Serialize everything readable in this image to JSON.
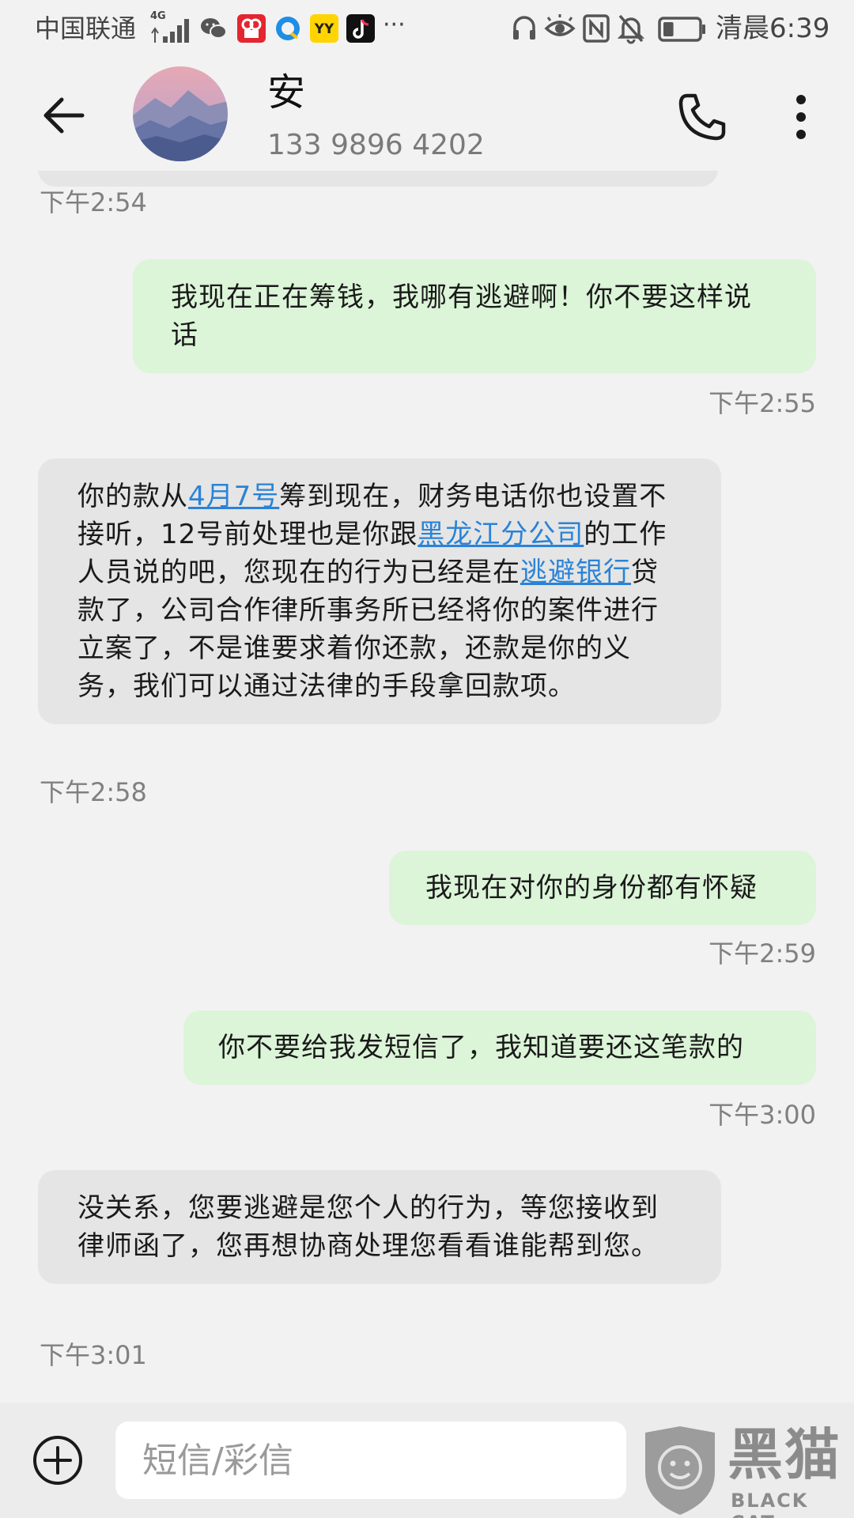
{
  "status_bar": {
    "carrier": "中国联通",
    "network": "4G",
    "time": "清晨6:39",
    "more": "···",
    "notification_icons": [
      "wechat-icon",
      "video-app-icon",
      "browser-app-icon",
      "yy-app-icon",
      "tiktok-icon"
    ],
    "system_icons": [
      "headset-icon",
      "eye-comfort-icon",
      "nfc-icon",
      "mute-icon",
      "battery-icon"
    ],
    "battery_level": 0.3
  },
  "header": {
    "contact_name": "安",
    "contact_number": "133 9896 4202",
    "back_icon": "back-arrow-icon",
    "call_icon": "phone-icon",
    "more_icon": "more-vertical-icon"
  },
  "messages": [
    {
      "direction": "incoming",
      "time": "下午2:54"
    },
    {
      "direction": "outgoing",
      "text": "我现在正在筹钱，我哪有逃避啊！你不要这样说话",
      "time": "下午2:55"
    },
    {
      "direction": "incoming",
      "segments": [
        {
          "text": "你的款从",
          "link": false
        },
        {
          "text": "4月7号",
          "link": true
        },
        {
          "text": "筹到现在，财务电话你也设置不接听，12号前处理也是你跟",
          "link": false
        },
        {
          "text": "黑龙江分公司",
          "link": true
        },
        {
          "text": "的工作人员说的吧，您现在的行为已经是在",
          "link": false
        },
        {
          "text": "逃避银行",
          "link": true
        },
        {
          "text": "贷款了，公司合作律所事务所已经将你的案件进行立案了，不是谁要求着你还款，还款是你的义务，我们可以通过法律的手段拿回款项。",
          "link": false
        }
      ],
      "time": "下午2:58"
    },
    {
      "direction": "outgoing",
      "text": "我现在对你的身份都有怀疑",
      "time": "下午2:59"
    },
    {
      "direction": "outgoing",
      "text": "你不要给我发短信了，我知道要还这笔款的",
      "time": "下午3:00"
    },
    {
      "direction": "incoming",
      "text": "没关系，您要逃避是您个人的行为，等您接收到律师函了，您再想协商处理您看看谁能帮到您。",
      "time": "下午3:01"
    }
  ],
  "composer": {
    "placeholder": "短信/彩信",
    "attach_icon": "add-circle-icon"
  },
  "watermark": {
    "brand_cn": "黑猫",
    "brand_en": "BLACK CAT"
  },
  "colors": {
    "outgoing_bubble": "#dcf5d8",
    "incoming_bubble": "#e5e5e5",
    "link": "#2a83d6",
    "background": "#f2f2f2"
  }
}
